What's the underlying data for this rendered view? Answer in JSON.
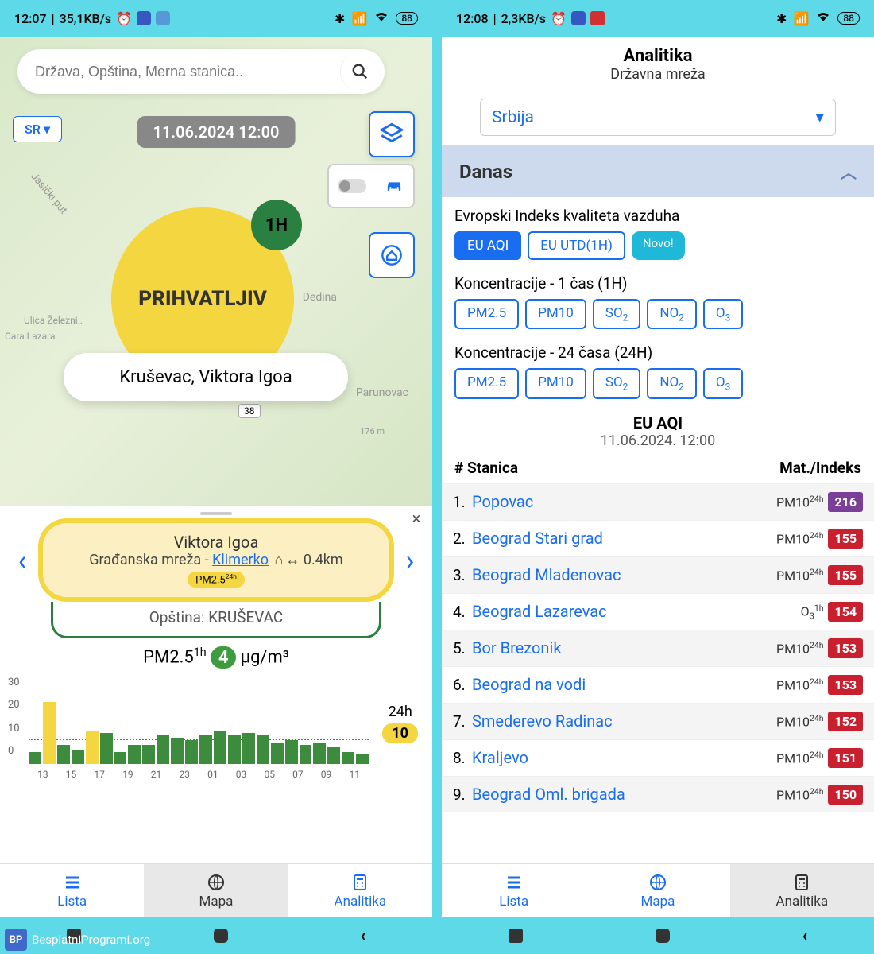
{
  "left": {
    "status": {
      "time": "12:07",
      "speed": "35,1KB/s",
      "battery": "88"
    },
    "search_placeholder": "Država, Opština, Merna stanica..",
    "lang": "SR",
    "timestamp": "11.06.2024 12:00",
    "h1_badge": "1H",
    "quality_label": "PRIHVATLJIV",
    "location": "Kruševac, Viktora Igoa",
    "map_labels": {
      "dedina": "Dedina",
      "parunovac": "Parunovac",
      "distance": "176 m",
      "road": "38",
      "zel": "Ulica Železni..",
      "cara": "Cara Lazara",
      "jas": "Jasički put"
    },
    "panel": {
      "title": "Viktora Igoa",
      "network": "Građanska mreža - ",
      "link": "Klimerko",
      "dist": "0.4km",
      "pm_tag": "PM2.5",
      "pm_tag_sup": "24h",
      "opstina": "Opština: KRUŠEVAC",
      "reading_pollutant": "PM2.5",
      "reading_sup": "1h",
      "reading_value": "4",
      "reading_unit": "μg/m³",
      "h24_label": "24h",
      "h24_value": "10"
    },
    "nav": {
      "lista": "Lista",
      "mapa": "Mapa",
      "analitika": "Analitika"
    }
  },
  "right": {
    "status": {
      "time": "12:08",
      "speed": "2,3KB/s",
      "battery": "88"
    },
    "title": "Analitika",
    "subtitle": "Državna mreža",
    "dropdown": "Srbija",
    "accordion": "Danas",
    "sec1_title": "Evropski Indeks kvaliteta vazduha",
    "sec1_chips": [
      "EU AQI",
      "EU UTD(1H)"
    ],
    "novo": "Novo!",
    "sec2_title": "Koncentracije - 1 čas (1H)",
    "pollutants": [
      "PM2.5",
      "PM10",
      "SO₂",
      "NO₂",
      "O₃"
    ],
    "sec3_title": "Koncentracije - 24 časa (24H)",
    "table_title": "EU AQI",
    "table_date": "11.06.2024. 12:00",
    "col1": "# Stanica",
    "col2": "Mat./Indeks",
    "rows": [
      {
        "n": "1.",
        "name": "Popovac",
        "mat": "PM10",
        "sup": "24h",
        "v": "216",
        "cls": "purple"
      },
      {
        "n": "2.",
        "name": "Beograd Stari grad",
        "mat": "PM10",
        "sup": "24h",
        "v": "155",
        "cls": ""
      },
      {
        "n": "3.",
        "name": "Beograd Mladenovac",
        "mat": "PM10",
        "sup": "24h",
        "v": "155",
        "cls": ""
      },
      {
        "n": "4.",
        "name": "Beograd Lazarevac",
        "mat": "O₃",
        "sup": "1h",
        "v": "154",
        "cls": ""
      },
      {
        "n": "5.",
        "name": "Bor Brezonik",
        "mat": "PM10",
        "sup": "24h",
        "v": "153",
        "cls": ""
      },
      {
        "n": "6.",
        "name": "Beograd na vodi",
        "mat": "PM10",
        "sup": "24h",
        "v": "153",
        "cls": ""
      },
      {
        "n": "7.",
        "name": "Smederevo Radinac",
        "mat": "PM10",
        "sup": "24h",
        "v": "152",
        "cls": ""
      },
      {
        "n": "8.",
        "name": "Kraljevo",
        "mat": "PM10",
        "sup": "24h",
        "v": "151",
        "cls": ""
      },
      {
        "n": "9.",
        "name": "Beograd Oml. brigada",
        "mat": "PM10",
        "sup": "24h",
        "v": "150",
        "cls": ""
      }
    ],
    "nav": {
      "lista": "Lista",
      "mapa": "Mapa",
      "analitika": "Analitika"
    }
  },
  "footer": "BesplatniProgrami.org",
  "chart_data": {
    "type": "bar",
    "title": "PM2.5 1h μg/m³",
    "ylabel": "μg/m³",
    "ylim": [
      0,
      30
    ],
    "threshold": 10,
    "x_labels": [
      "13",
      "15",
      "17",
      "19",
      "21",
      "23",
      "01",
      "03",
      "05",
      "07",
      "09",
      "11"
    ],
    "values": [
      5,
      26,
      8,
      6,
      14,
      13,
      5,
      8,
      8,
      12,
      11,
      10,
      12,
      14,
      12,
      13,
      12,
      9,
      10,
      8,
      9,
      7,
      5,
      4
    ],
    "highlight_indices": [
      1,
      4
    ],
    "avg_24h": 10
  }
}
